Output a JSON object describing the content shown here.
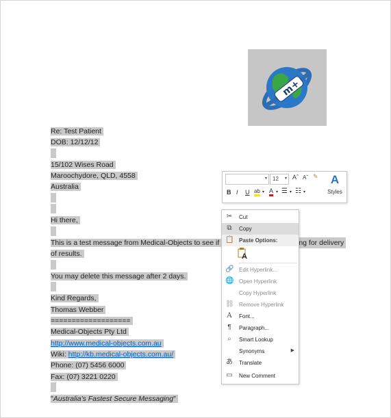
{
  "document": {
    "lines": [
      "Re: Test Patient",
      "DOB: 12/12/12",
      "",
      "15/102 Wises Road",
      "Maroochydore, QLD, 4558",
      "Australia",
      "",
      "",
      "Hi there,",
      "",
      "This is a test message from Medical-Objects to see if",
      "of results.",
      "",
      "You may delete this message after 2 days.",
      "",
      "Kind Regards,",
      "Thomas Webber",
      "===================",
      "Medical-Objects Pty Ltd",
      "http://www.medical-objects.com.au",
      "Wiki: ",
      "Phone: (07) 5456 6000",
      "Fax: (07) 3221 0220",
      "",
      "\"",
      "Australia's Fastest Secure Messaging",
      "\""
    ],
    "wiki_link": "http://kb.medical-objects.com.au/",
    "line_tail": "ing for delivery"
  },
  "mini_toolbar": {
    "font_name": "",
    "font_size": "12",
    "grow_font": "Aˆ",
    "shrink_font": "Aˇ",
    "bold": "B",
    "italic": "I",
    "underline": "U",
    "highlight": "ab",
    "font_color": "A",
    "styles_label": "Styles"
  },
  "context_menu": {
    "items": [
      {
        "label": "Cut",
        "icon": "scissors-icon",
        "enabled": true
      },
      {
        "label": "Copy",
        "icon": "copy-icon",
        "enabled": true,
        "hover": true
      },
      {
        "label": "Paste Options:",
        "icon": "paste-icon",
        "enabled": true,
        "header": true
      },
      {
        "label": "Edit Hyperlink...",
        "icon": "edit-hyperlink-icon",
        "enabled": false
      },
      {
        "label": "Open Hyperlink",
        "icon": "open-hyperlink-icon",
        "enabled": false
      },
      {
        "label": "Copy Hyperlink",
        "icon": "",
        "enabled": false
      },
      {
        "label": "Remove Hyperlink",
        "icon": "remove-hyperlink-icon",
        "enabled": false
      },
      {
        "label": "Font...",
        "icon": "font-icon",
        "enabled": true
      },
      {
        "label": "Paragraph...",
        "icon": "paragraph-icon",
        "enabled": true
      },
      {
        "label": "Smart Lookup",
        "icon": "smart-lookup-icon",
        "enabled": true
      },
      {
        "label": "Synonyms",
        "icon": "",
        "enabled": true,
        "submenu": true
      },
      {
        "label": "Translate",
        "icon": "translate-icon",
        "enabled": true
      },
      {
        "label": "New Comment",
        "icon": "new-comment-icon",
        "enabled": true
      }
    ],
    "paste_option_glyph": "A"
  },
  "colors": {
    "highlight": "#c9c9c9",
    "link": "#0563c1",
    "menu_hover": "#dcdcdc",
    "styles_accent": "#2b74c7"
  }
}
